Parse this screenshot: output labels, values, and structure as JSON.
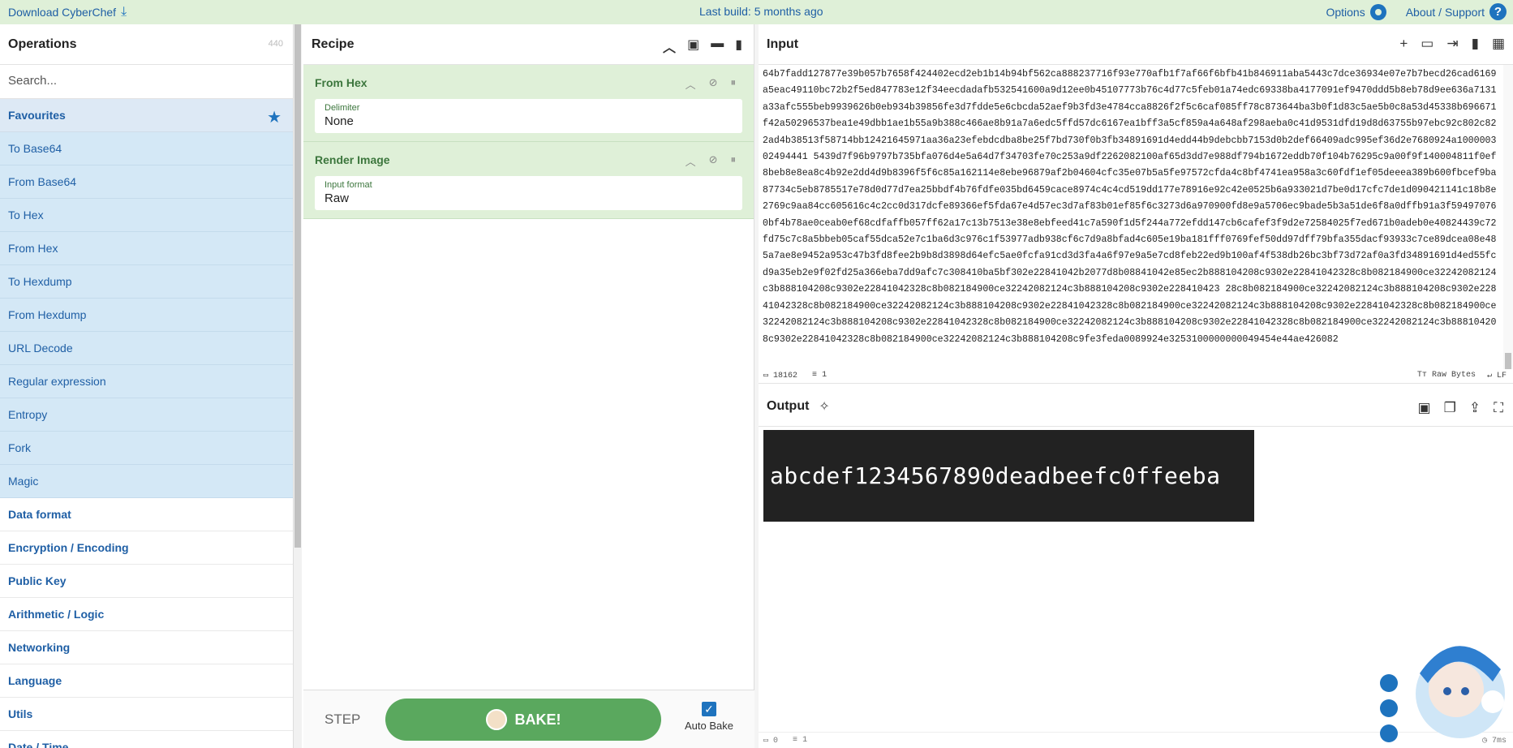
{
  "banner": {
    "download": "Download CyberChef",
    "last_build": "Last build: 5 months ago",
    "options": "Options",
    "about": "About / Support"
  },
  "operations": {
    "title": "Operations",
    "count": "440",
    "search_placeholder": "Search...",
    "favourites": "Favourites",
    "items": [
      "To Base64",
      "From Base64",
      "To Hex",
      "From Hex",
      "To Hexdump",
      "From Hexdump",
      "URL Decode",
      "Regular expression",
      "Entropy",
      "Fork",
      "Magic"
    ],
    "categories": [
      "Data format",
      "Encryption / Encoding",
      "Public Key",
      "Arithmetic / Logic",
      "Networking",
      "Language",
      "Utils",
      "Date / Time"
    ]
  },
  "recipe": {
    "title": "Recipe",
    "ops": [
      {
        "name": "From Hex",
        "field_label": "Delimiter",
        "field_value": "None"
      },
      {
        "name": "Render Image",
        "field_label": "Input format",
        "field_value": "Raw"
      }
    ],
    "step": "STEP",
    "bake": "BAKE!",
    "auto_bake": "Auto Bake"
  },
  "input": {
    "title": "Input",
    "text": "64b7fadd127877e39b057b7658f424402ecd2eb1b14b94bf562ca888237716f93e770afb1f7af66f6bfb41b846911aba5443c7dce36934e07e7b7becd26cad6169a5eac49110bc72b2f5ed847783e12f34eecdadafb532541600a9d12ee0b45107773b76c4d77c5feb01a74edc69338ba4177091ef9470ddd5b8eb78d9ee636a7131a33afc555beb9939626b0eb934b39856fe3d7fdde5e6cbcda52aef9b3fd3e4784cca8826f2f5c6caf085ff78c873644ba3b0f1d83c5ae5b0c8a53d45338b696671f42a50296537bea1e49dbb1ae1b55a9b388c466ae8b91a7a6edc5ffd57dc6167ea1bff3a5cf859a4a648af298aeba0c41d9531dfd19d8d63755b97ebc92c802c822ad4b38513f58714bb12421645971aa36a23efebdcdba8be25f7bd730f0b3fb34891691d4edd44b9debcbb7153d0b2def66409adc995ef36d2e7680924a100000302494441 5439d7f96b9797b735bfa076d4e5a64d7f34703fe70c253a9df2262082100af65d3dd7e988df794b1672eddb70f104b76295c9a00f9f140004811f0ef8beb8e8ea8c4b92e2dd4d9b8396f5f6c85a162114e8ebe96879af2b04604cfc35e07b5a5fe97572cfda4c8bf4741ea958a3c60fdf1ef05deeea389b600fbcef9ba87734c5eb8785517e78d0d77d7ea25bbdf4b76fdfe035bd6459cace8974c4c4cd519dd177e78916e92c42e0525b6a933021d7be0d17cfc7de1d090421141c18b8e2769c9aa84cc605616c4c2cc0d317dcfe89366ef5fda67e4d57ec3d7af83b01ef85f6c3273d6a970900fd8e9a5706ec9bade5b3a51de6f8a0dffb91a3f594970760bf4b78ae0ceab0ef68cdfaffb057ff62a17c13b7513e38e8ebfeed41c7a590f1d5f244a772efdd147cb6cafef3f9d2e72584025f7ed671b0adeb0e40824439c72fd75c7c8a5bbeb05caf55dca52e7c1ba6d3c976c1f53977adb938cf6c7d9a8bfad4c605e19ba181fff0769fef50dd97dff79bfa355dacf93933c7ce89dcea08e485a7ae8e9452a953c47b3fd8fee2b9b8d3898d64efc5ae0fcfa91cd3d3fa4a6f97e9a5e7cd8feb22ed9b100af4f538db26bc3bf73d72af0a3fd34891691d4ed55fcd9a35eb2e9f02fd25a366eba7dd9afc7c308410ba5bf302e22841042b2077d8b08841042e85ec2b888104208c9302e22841042328c8b082184900ce32242082124c3b888104208c9302e22841042328c8b082184900ce32242082124c3b888104208c9302e228410423 28c8b082184900ce32242082124c3b888104208c9302e22841042328c8b082184900ce32242082124c3b888104208c9302e22841042328c8b082184900ce32242082124c3b888104208c9302e22841042328c8b082184900ce32242082124c3b888104208c9302e22841042328c8b082184900ce32242082124c3b888104208c9302e22841042328c8b082184900ce32242082124c3b888104208c9302e22841042328c8b082184900ce32242082124c3b888104208c9fe3feda0089924e3253100000000049454e44ae426082",
    "length": "18162",
    "lines": "1",
    "encoding": "Raw Bytes",
    "eol": "LF"
  },
  "output": {
    "title": "Output",
    "rendered_text": "abcdef1234567890deadbeefc0ffeeba",
    "length": "0",
    "lines": "1",
    "time": "7ms"
  }
}
